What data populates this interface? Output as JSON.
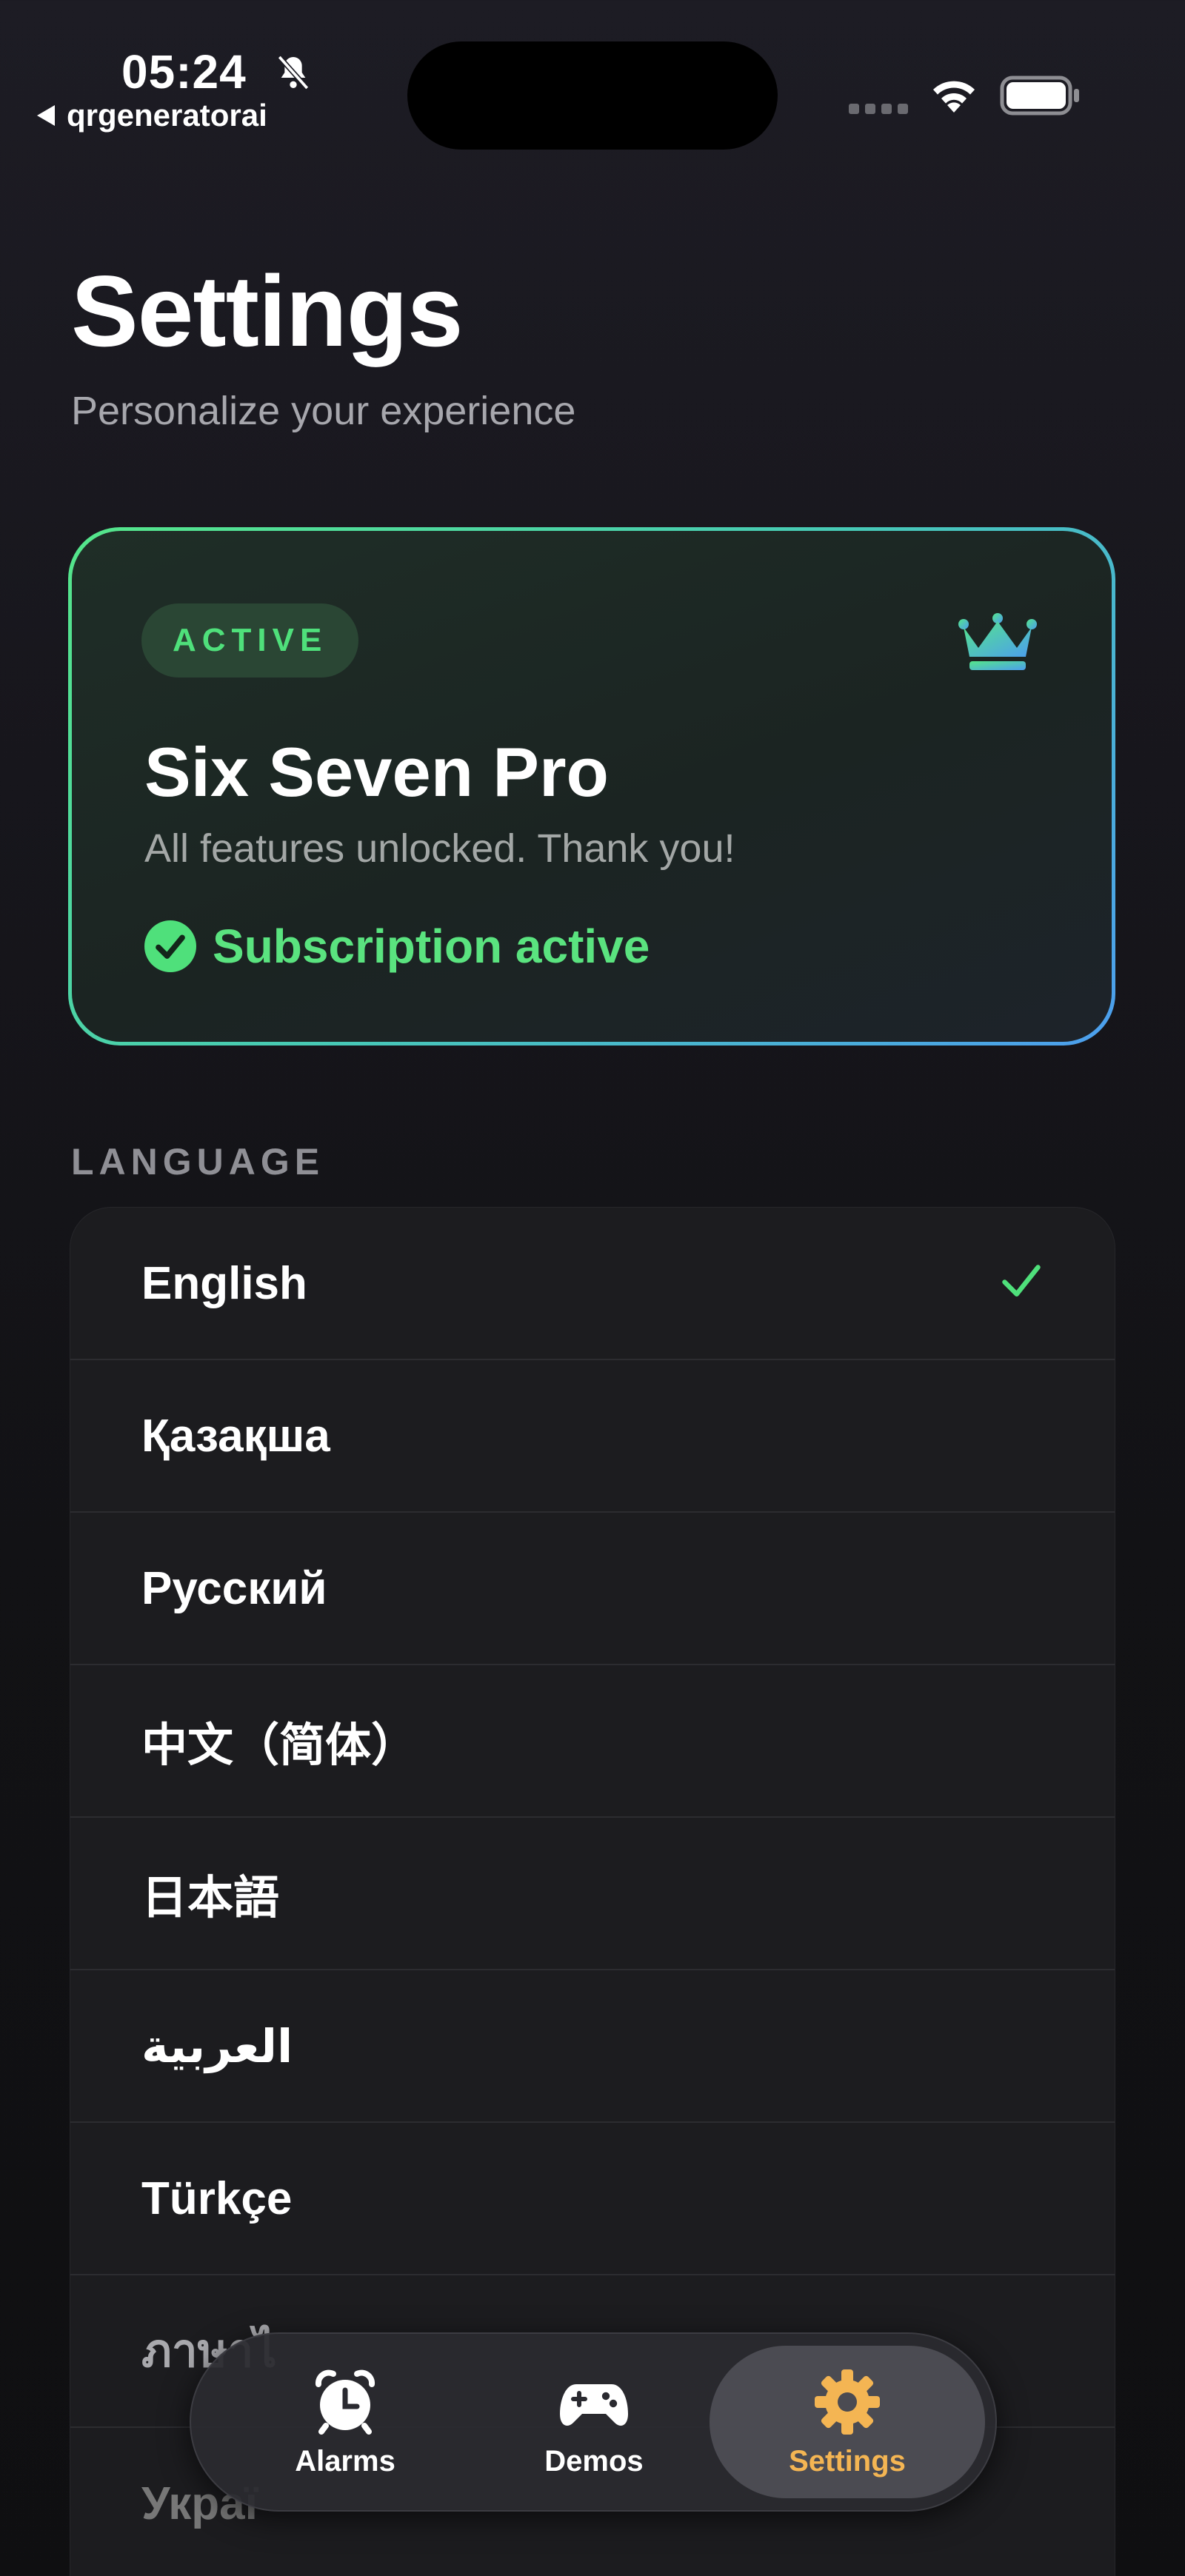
{
  "status_bar": {
    "time": "05:24",
    "back_app": "qrgeneratorai",
    "icons": [
      "bell-slash-icon",
      "signal-icon",
      "wifi-icon",
      "battery-icon"
    ]
  },
  "header": {
    "title": "Settings",
    "subtitle": "Personalize your experience"
  },
  "subscription": {
    "badge": "ACTIVE",
    "icon": "crown-icon",
    "title": "Six Seven Pro",
    "description": "All features unlocked. Thank you!",
    "status": "Subscription active",
    "colors": {
      "accent_green": "#4fe07b",
      "accent_blue": "#4c9eee"
    }
  },
  "language": {
    "section_label": "LANGUAGE",
    "selected": "English",
    "items": [
      {
        "label": "English"
      },
      {
        "label": "Қазақша"
      },
      {
        "label": "Русский"
      },
      {
        "label": "中文（简体）"
      },
      {
        "label": "日本語"
      },
      {
        "label": "العربية"
      },
      {
        "label": "Türkçe"
      },
      {
        "label": "ภาษาไ"
      },
      {
        "label": "Украї"
      }
    ]
  },
  "tab_bar": {
    "tabs": [
      {
        "label": "Alarms",
        "icon": "alarm-clock-icon"
      },
      {
        "label": "Demos",
        "icon": "gamepad-icon"
      },
      {
        "label": "Settings",
        "icon": "gear-icon"
      }
    ],
    "active": "Settings",
    "active_color": "#f4b553"
  }
}
